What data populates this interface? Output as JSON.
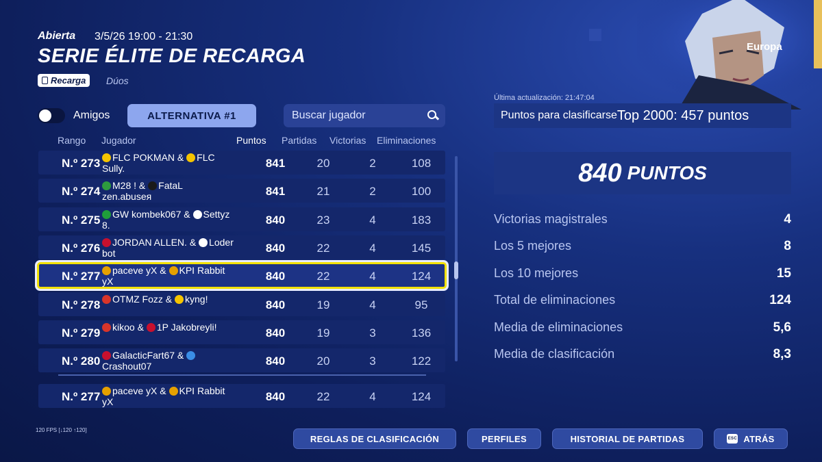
{
  "header": {
    "status": "Abierta",
    "datetime": "3/5/26 19:00 - 21:30",
    "title": "SERIE ÉLITE DE RECARGA",
    "mode_badge": "Recarga",
    "mode_sub": "Dúos"
  },
  "controls": {
    "friends_label": "Amigos",
    "alternative_label": "ALTERNATIVA #1",
    "search_placeholder": "Buscar jugador"
  },
  "columns": {
    "rank": "Rango",
    "player": "Jugador",
    "points": "Puntos",
    "games": "Partidas",
    "wins": "Victorias",
    "elims": "Eliminaciones"
  },
  "rows": [
    {
      "rank": "N.º 273",
      "player": "FLC POKMAN & FLC Sully.",
      "flag1": "#f5c400",
      "flag2": "#f5c400",
      "p1": "FLC POKMAN &",
      "p2": "FLC",
      "p3": "Sully.",
      "points": "841",
      "games": "20",
      "wins": "2",
      "elims": "108"
    },
    {
      "rank": "N.º 274",
      "p1": "M28 ! &",
      "p2": "FataL",
      "p3": "zen.abuseя",
      "flag1": "#2e9b3e",
      "flag2": "#1a1a1a",
      "points": "841",
      "games": "21",
      "wins": "2",
      "elims": "100"
    },
    {
      "rank": "N.º 275",
      "p1": "GW kombek067 &",
      "p2": "Settyz",
      "p3": "8.",
      "flag1": "#1f9d3a",
      "flag2": "#ffffff",
      "points": "840",
      "games": "23",
      "wins": "4",
      "elims": "183"
    },
    {
      "rank": "N.º 276",
      "p1": "JORDAN ALLEN. &",
      "p2": "Loder",
      "p3": "bot",
      "flag1": "#c8102e",
      "flag2": "#ffffff",
      "points": "840",
      "games": "22",
      "wins": "4",
      "elims": "145"
    },
    {
      "rank": "N.º 277",
      "p1": "paceve yX &",
      "p2": "KPI Rabbit",
      "p3": "yX",
      "flag1": "#e5a000",
      "flag2": "#e5a000",
      "points": "840",
      "games": "22",
      "wins": "4",
      "elims": "124",
      "selected": true
    },
    {
      "rank": "N.º 278",
      "p1": "OTMZ Fozz &",
      "p2": "kyng!",
      "p3": "",
      "flag1": "#d8352a",
      "flag2": "#f5c400",
      "points": "840",
      "games": "19",
      "wins": "4",
      "elims": "95"
    },
    {
      "rank": "N.º 279",
      "p1": "kikoo &",
      "p2": "1P Jakobreyli!",
      "p3": "",
      "flag1": "#d8352a",
      "flag2": "#c8102e",
      "points": "840",
      "games": "19",
      "wins": "3",
      "elims": "136"
    },
    {
      "rank": "N.º 280",
      "p1": "GalacticFart67 &",
      "p2": "",
      "p3": "Crashout07",
      "flag1": "#c8102e",
      "flag2": "#3a8ee6",
      "points": "840",
      "games": "20",
      "wins": "3",
      "elims": "122"
    }
  ],
  "my_row": {
    "rank": "N.º 277",
    "p1": "paceve yX &",
    "p2": "KPI Rabbit",
    "p3": "yX",
    "flag1": "#e5a000",
    "flag2": "#e5a000",
    "points": "840",
    "games": "22",
    "wins": "4",
    "elims": "124"
  },
  "right": {
    "region": "Europa",
    "updated": "Última actualización: 21:47:04",
    "qualify_label": "Puntos para clasificarse",
    "qualify_value": "Top 2000: 457 puntos",
    "points_num": "840",
    "points_label": "PUNTOS",
    "stats": [
      {
        "label": "Victorias magistrales",
        "value": "4"
      },
      {
        "label": "Los 5 mejores",
        "value": "8"
      },
      {
        "label": "Los 10 mejores",
        "value": "15"
      },
      {
        "label": "Total de eliminaciones",
        "value": "124"
      },
      {
        "label": "Media de eliminaciones",
        "value": "5,6"
      },
      {
        "label": "Media de clasificación",
        "value": "8,3"
      }
    ]
  },
  "footer": {
    "fps": "120 FPS [↓120 ↑120]",
    "buttons": [
      "REGLAS DE CLASIFICACIÓN",
      "PERFILES",
      "HISTORIAL DE PARTIDAS",
      "ATRÁS"
    ],
    "esc_key": "ESC"
  },
  "colors": {
    "selection": "#f2e100",
    "panel": "#1c3584",
    "row": "#14276b"
  }
}
